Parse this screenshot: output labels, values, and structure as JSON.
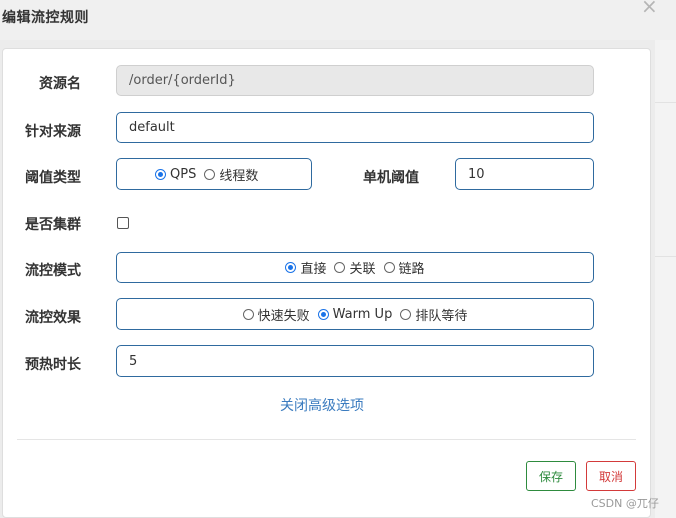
{
  "dialog": {
    "title": "编辑流控规则",
    "close_symbol": "×"
  },
  "form": {
    "resource": {
      "label": "资源名",
      "value": "/order/{orderId}"
    },
    "limit_app": {
      "label": "针对来源",
      "value": "default"
    },
    "threshold_type": {
      "label": "阈值类型",
      "options": [
        {
          "label": "QPS",
          "selected": true
        },
        {
          "label": "线程数",
          "selected": false
        }
      ]
    },
    "single_threshold": {
      "label": "单机阈值",
      "value": "10"
    },
    "cluster_mode": {
      "label": "是否集群",
      "checked": false
    },
    "strategy": {
      "label": "流控模式",
      "options": [
        {
          "label": "直接",
          "selected": true
        },
        {
          "label": "关联",
          "selected": false
        },
        {
          "label": "链路",
          "selected": false
        }
      ]
    },
    "control_behavior": {
      "label": "流控效果",
      "options": [
        {
          "label": "快速失败",
          "selected": false
        },
        {
          "label": "Warm Up",
          "selected": true
        },
        {
          "label": "排队等待",
          "selected": false
        }
      ]
    },
    "warmup_period": {
      "label": "预热时长",
      "value": "5"
    },
    "advanced_link": "关闭高级选项"
  },
  "footer": {
    "save_label": "保存",
    "cancel_label": "取消"
  },
  "watermark": "CSDN @兀仔",
  "colors": {
    "accent": "#1a73e8",
    "input_border": "#2f6a9f",
    "link": "#3a7bbf",
    "save": "#2e8b3e",
    "cancel": "#d33a3a"
  }
}
